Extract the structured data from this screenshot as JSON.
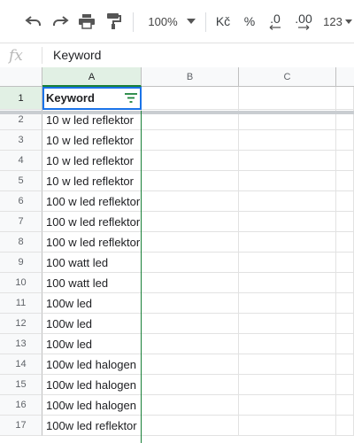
{
  "toolbar": {
    "zoom": "100%",
    "currency": "Kč",
    "percent": "%",
    "decrease_decimals": ".0",
    "increase_decimals": ".00",
    "more_formats": "123"
  },
  "formula_bar": {
    "fx_label": "fx",
    "content": "Keyword"
  },
  "columns": [
    "A",
    "B",
    "C"
  ],
  "rows": [
    {
      "num": "1",
      "a": "Keyword"
    },
    {
      "num": "2",
      "a": "10 w led reflektor"
    },
    {
      "num": "3",
      "a": "10 w led reflektor"
    },
    {
      "num": "4",
      "a": "10 w led reflektor"
    },
    {
      "num": "5",
      "a": "10 w led reflektor"
    },
    {
      "num": "6",
      "a": "100 w led reflektor"
    },
    {
      "num": "7",
      "a": "100 w led reflektor"
    },
    {
      "num": "8",
      "a": "100 w led reflektor"
    },
    {
      "num": "9",
      "a": "100 watt led"
    },
    {
      "num": "10",
      "a": "100 watt led"
    },
    {
      "num": "11",
      "a": "100w led"
    },
    {
      "num": "12",
      "a": "100w led"
    },
    {
      "num": "13",
      "a": "100w led"
    },
    {
      "num": "14",
      "a": "100w led halogen"
    },
    {
      "num": "15",
      "a": "100w led halogen"
    },
    {
      "num": "16",
      "a": "100w led halogen"
    },
    {
      "num": "17",
      "a": "100w led reflektor"
    }
  ],
  "colors": {
    "selection_green": "#188038",
    "active_blue": "#1a73e8"
  }
}
